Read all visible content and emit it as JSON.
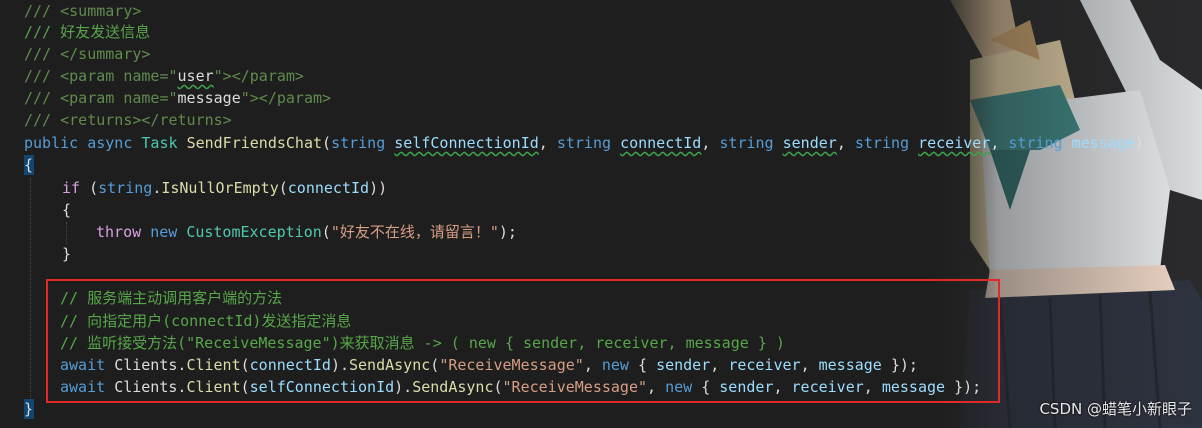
{
  "code": {
    "l1": "/// <summary>",
    "l2": "/// 好友发送信息",
    "l3": "/// </summary>",
    "l4a": "/// <param name=\"",
    "l4b": "user",
    "l4c": "\"></param>",
    "l5a": "/// <param name=\"",
    "l5b": "message",
    "l5c": "\"></param>",
    "l6": "/// <returns></returns>",
    "l7": {
      "public": "public",
      "async": "async",
      "task": "Task",
      "name": "SendFriendsChat",
      "string": "string",
      "p1": "selfConnectionId",
      "p2": "connectId",
      "p3": "sender",
      "p4": "receiver",
      "p5": "message"
    },
    "l8": "{",
    "l9": {
      "if": "if",
      "string": "string",
      "method": "IsNullOrEmpty",
      "arg": "connectId"
    },
    "l10": "{",
    "l11": {
      "throw": "throw",
      "new": "new",
      "type": "CustomException",
      "msg": "\"好友不在线，请留言！\""
    },
    "l12": "}",
    "l13": "// 服务端主动调用客户端的方法",
    "l14": "// 向指定用户(connectId)发送指定消息",
    "l15": "// 监听接受方法(\"ReceiveMessage\")来获取消息 -> ( new { sender, receiver, message } )",
    "l16": {
      "await": "await",
      "clients": "Clients",
      "client": "Client",
      "arg": "connectId",
      "send": "SendAsync",
      "msg": "\"ReceiveMessage\"",
      "new": "new",
      "f1": "sender",
      "f2": "receiver",
      "f3": "message"
    },
    "l17": {
      "await": "await",
      "clients": "Clients",
      "client": "Client",
      "arg": "selfConnectionId",
      "send": "SendAsync",
      "msg": "\"ReceiveMessage\"",
      "new": "new",
      "f1": "sender",
      "f2": "receiver",
      "f3": "message"
    },
    "l18": "}"
  },
  "watermark": "CSDN @蜡笔小新眼子"
}
